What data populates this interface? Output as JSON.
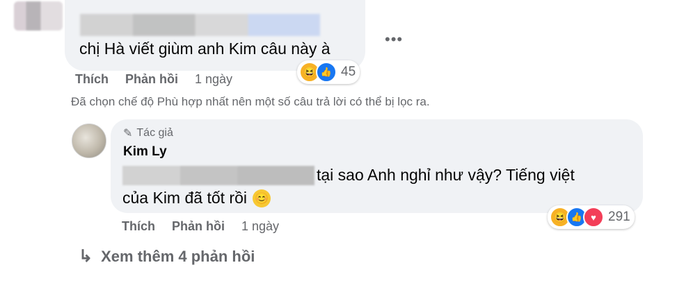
{
  "comment": {
    "text": "chị Hà viết giùm anh Kim câu này à",
    "more_icon": "more-horizontal-icon",
    "actions": {
      "like": "Thích",
      "reply": "Phản hồi",
      "time": "1 ngày"
    },
    "reactions": {
      "icons": [
        "haha-icon",
        "like-icon"
      ],
      "count": "45"
    }
  },
  "filter_note": "Đã chọn chế độ Phù hợp nhất nên một số câu trả lời có thể bị lọc ra.",
  "reply": {
    "badge": "Tác giả",
    "badge_icon": "pen-icon",
    "name": "Kim Ly",
    "text_line1": "tại sao Anh nghỉ như vậy? Tiếng việt",
    "text_line2": "của Kim đã tốt rồi",
    "emoji": "😊",
    "actions": {
      "like": "Thích",
      "reply": "Phản hồi",
      "time": "1 ngày"
    },
    "reactions": {
      "icons": [
        "haha-icon",
        "like-icon",
        "love-icon"
      ],
      "count": "291"
    }
  },
  "more_replies": "Xem thêm 4 phản hồi",
  "colors": {
    "bubble": "#f0f2f5",
    "meta": "#65676b",
    "like": "#1877f2",
    "love": "#f33e58",
    "haha": "#f7b125"
  }
}
